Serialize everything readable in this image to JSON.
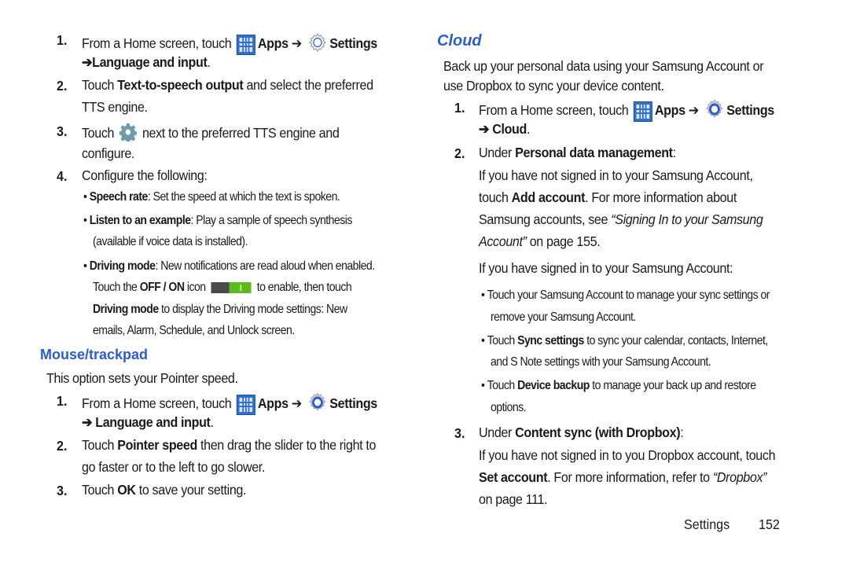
{
  "left": {
    "tts_steps": [
      {
        "num": "1.",
        "line1_pre": "From a Home screen, touch",
        "apps": "Apps",
        "arrow": "➔",
        "settings": "Settings",
        "line2": "➔Language and input",
        "line2_end": "."
      },
      {
        "num": "2.",
        "pre": "Touch ",
        "bold": "Text-to-speech output",
        "post": " and select the preferred",
        "line2": "TTS engine."
      },
      {
        "num": "3.",
        "pre": "Touch",
        "post": "next to the preferred TTS engine and",
        "line2": "configure."
      },
      {
        "num": "4.",
        "text": "Configure the following:"
      }
    ],
    "bullets": {
      "speech_rate": {
        "bold": "Speech rate",
        "text": ": Set the speed at which the text is spoken."
      },
      "listen": {
        "bold": "Listen to an example",
        "text": ": Play a sample of speech synthesis",
        "line2": "(available if voice data is installed)."
      },
      "driving": {
        "bold": "Driving mode",
        "text": ": New notifications are read aloud when enabled.",
        "l2_pre": "Touch the ",
        "l2_bold": "OFF / ON",
        "l2_mid": " icon",
        "l2_post": "to enable, then touch",
        "l3_bold": "Driving mode",
        "l3_text": " to display the Driving mode settings: New",
        "l4": "emails, Alarm, Schedule, and Unlock screen."
      }
    },
    "mouse_heading": "Mouse/trackpad",
    "mouse_intro": "This option sets your Pointer speed.",
    "mouse_steps": [
      {
        "num": "1.",
        "line1_pre": "From a Home screen, touch",
        "apps": "Apps",
        "arrow": "➔",
        "settings": "Settings",
        "line2": "➔ Language and input",
        "line2_end": "."
      },
      {
        "num": "2.",
        "pre": "Touch ",
        "bold": "Pointer speed",
        "post": " then drag the slider to the right to",
        "line2": "go faster or to the left to go slower."
      },
      {
        "num": "3.",
        "pre": "Touch ",
        "bold": "OK",
        "post": " to save your setting."
      }
    ]
  },
  "right": {
    "cloud_heading": "Cloud",
    "intro_1": "Back up your personal data using your Samsung Account or",
    "intro_2": "use Dropbox to sync your device content.",
    "step1": {
      "num": "1.",
      "line1_pre": "From a Home screen, touch",
      "apps": "Apps",
      "arrow": "➔",
      "settings": "Settings",
      "line2": "➔ Cloud",
      "line2_end": "."
    },
    "step2": {
      "num": "2.",
      "pre": "Under ",
      "bold": "Personal data management",
      "post": ":",
      "p1": "If you have not signed in to your Samsung Account,",
      "p2_pre": "touch ",
      "p2_bold": "Add account",
      "p2_post": ". For more information about",
      "p3_pre": "Samsung accounts, see ",
      "p3_italic": "“Signing In to your Samsung",
      "p4_italic": "Account”",
      "p4_post": " on page 155.",
      "p5": "If you have signed in to your Samsung Account:"
    },
    "bullets": [
      {
        "pre": "Touch your Samsung Account to manage your sync settings or",
        "line2": "remove your Samsung Account."
      },
      {
        "pre": "Touch ",
        "bold": "Sync settings",
        "post": " to sync your calendar, contacts, Internet,",
        "line2": "and S Note settings with your Samsung Account."
      },
      {
        "pre": "Touch ",
        "bold": "Device backup",
        "post": " to manage your back up and restore",
        "line2": "options."
      }
    ],
    "step3": {
      "num": "3.",
      "pre": "Under ",
      "bold": "Content sync (with Dropbox)",
      "post": ":",
      "p1": "If you have not signed in to you Dropbox account, touch",
      "p2_bold": "Set account",
      "p2_post": ". For more information, refer to ",
      "p2_italic": "“Dropbox”",
      "p3": "on page 111."
    }
  },
  "footer": {
    "section": "Settings",
    "page": "152"
  },
  "colors": {
    "heading": "#2a5bd7",
    "apps_icon": "#2f6fd1",
    "toggle_on": "#5bbb1c",
    "gear": "#6f9aa8"
  }
}
